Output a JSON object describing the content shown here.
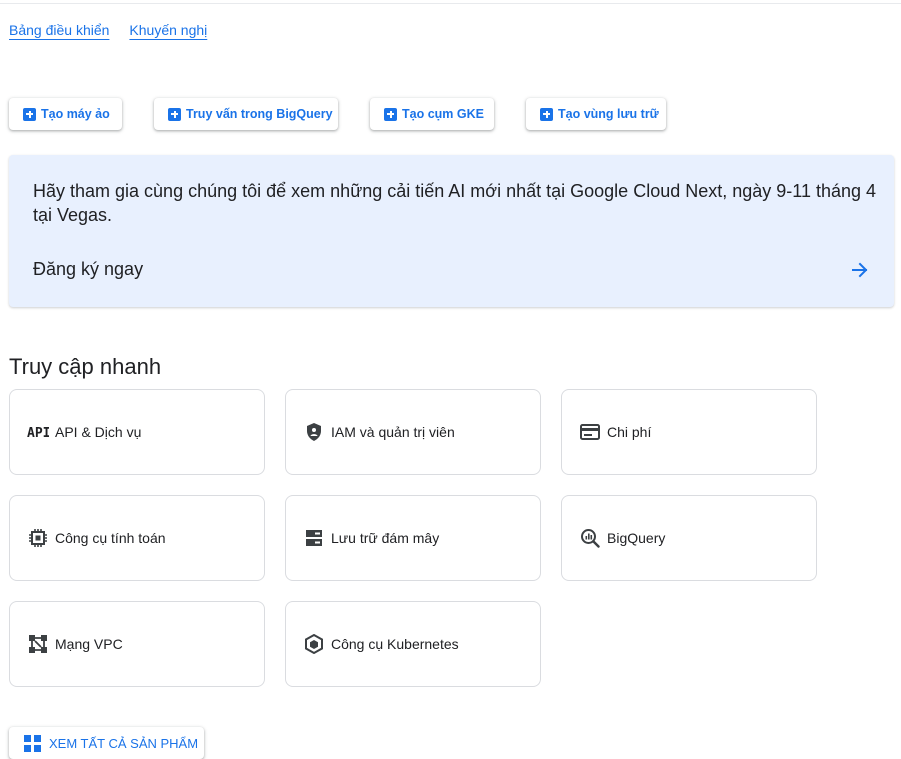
{
  "tabs": [
    {
      "label": "Bảng điều khiển"
    },
    {
      "label": "Khuyến nghị"
    }
  ],
  "actions": [
    {
      "label": "Tạo máy ảo",
      "icon": "add-box-icon"
    },
    {
      "label": "Truy vấn trong BigQuery",
      "icon": "add-box-icon"
    },
    {
      "label": "Tạo cụm GKE",
      "icon": "add-box-icon"
    },
    {
      "label": "Tạo vùng lưu trữ",
      "icon": "add-box-icon"
    }
  ],
  "banner": {
    "text": "Hãy tham gia cùng chúng tôi để xem những cải tiến AI mới nhất tại Google Cloud Next, ngày 9-11 tháng 4 tại Vegas.",
    "link": "Đăng ký ngay",
    "icon": "arrow-right-icon"
  },
  "quick_access": {
    "title": "Truy cập nhanh",
    "items": [
      {
        "label": "API & Dịch vụ",
        "icon": "api-icon"
      },
      {
        "label": "IAM và quản trị viên",
        "icon": "shield-icon"
      },
      {
        "label": "Chi phí",
        "icon": "billing-icon"
      },
      {
        "label": "Công cụ tính toán",
        "icon": "chip-icon"
      },
      {
        "label": "Lưu trữ đám mây",
        "icon": "storage-icon"
      },
      {
        "label": "BigQuery",
        "icon": "bigquery-icon"
      },
      {
        "label": "Mạng VPC",
        "icon": "vpc-network-icon"
      },
      {
        "label": "Công cụ Kubernetes",
        "icon": "kubernetes-icon"
      }
    ]
  },
  "view_all": {
    "label": "XEM TẤT CẢ SẢN PHẨM",
    "icon": "grid-icon"
  },
  "colors": {
    "accent": "#1a73e8",
    "banner_bg": "#e8f0fe",
    "card_border": "#dadce0",
    "text": "#202124"
  }
}
